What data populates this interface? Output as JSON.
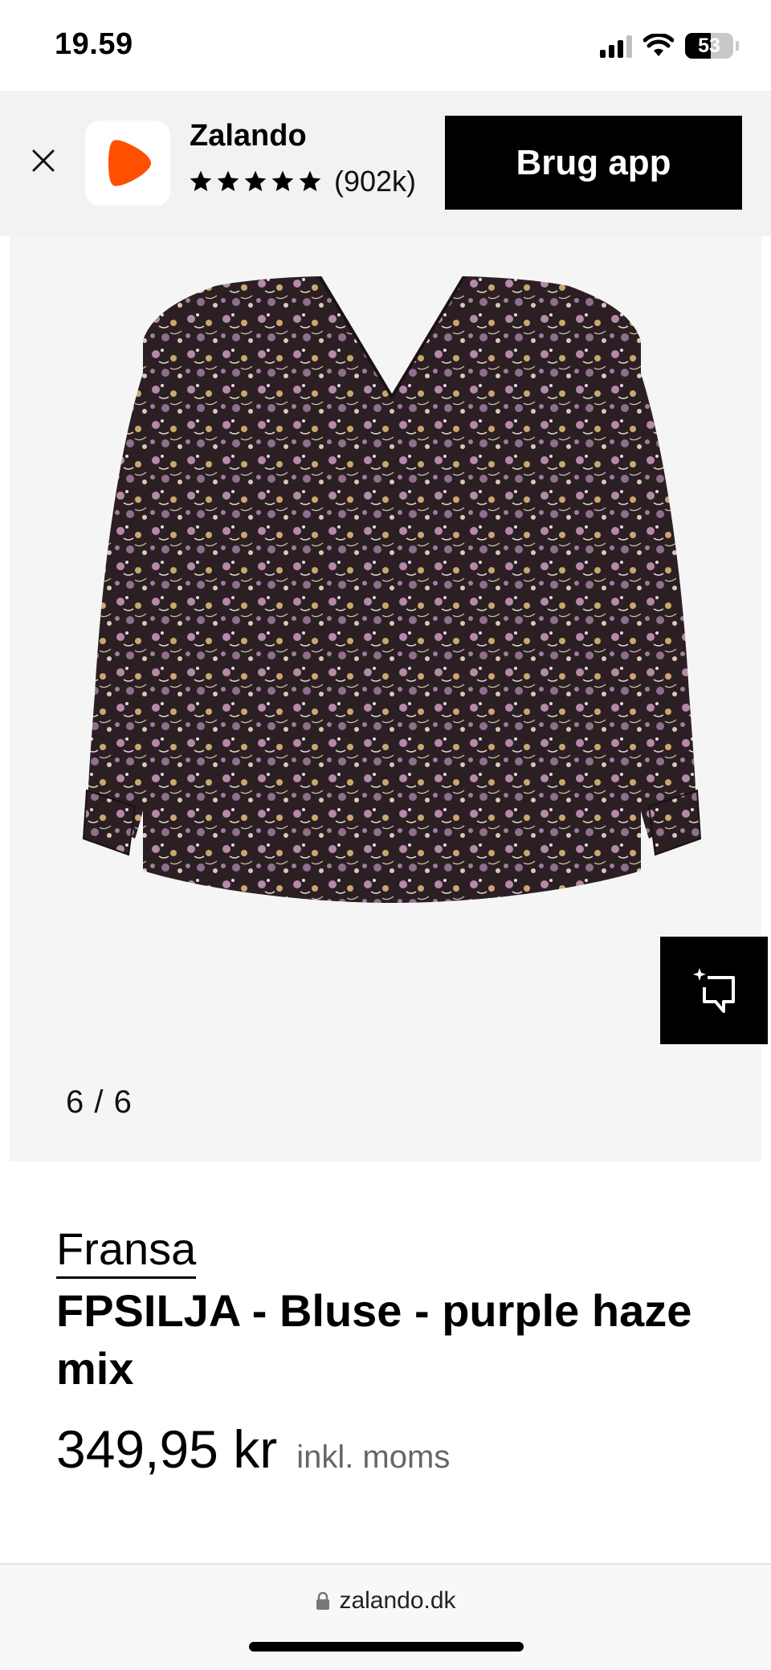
{
  "status_bar": {
    "time": "19.59",
    "battery_percent": "53",
    "battery_level": 0.53,
    "icons": [
      "cellular-signal-icon",
      "wifi-icon",
      "battery-icon"
    ]
  },
  "app_banner": {
    "close_icon": "close-icon",
    "app_icon": "zalando-logo-icon",
    "app_name": "Zalando",
    "rating_stars": 5,
    "rating_count": "(902k)",
    "cta_label": "Brug app",
    "logo_color": "#ff4f00"
  },
  "gallery": {
    "counter": "6 / 6",
    "current": 6,
    "total": 6,
    "fab_icon": "ai-sparkle-chat-icon"
  },
  "product": {
    "brand": "Fransa",
    "title": "FPSILJA - Bluse - purple haze mix",
    "price": "349,95 kr",
    "vat_note": "inkl. moms"
  },
  "browser": {
    "url": "zalando.dk",
    "lock_icon": "lock-icon"
  }
}
